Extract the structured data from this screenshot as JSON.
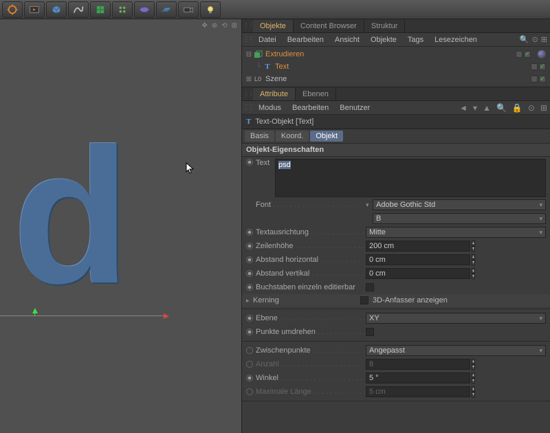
{
  "panel_tabs": {
    "objects": "Objekte",
    "content_browser": "Content Browser",
    "structure": "Struktur"
  },
  "obj_menu": {
    "file": "Datei",
    "edit": "Bearbeiten",
    "view": "Ansicht",
    "objects": "Objekte",
    "tags": "Tags",
    "bookmarks": "Lesezeichen"
  },
  "hierarchy": {
    "extrude": "Extrudieren",
    "text": "Text",
    "scene": "Szene"
  },
  "attr_tabs": {
    "attribute": "Attribute",
    "layers": "Ebenen"
  },
  "attr_menu": {
    "mode": "Modus",
    "edit": "Bearbeiten",
    "user": "Benutzer"
  },
  "attr_title": "Text-Objekt [Text]",
  "subtabs": {
    "basic": "Basis",
    "coord": "Koord.",
    "object": "Objekt"
  },
  "section": "Objekt-Eigenschaften",
  "props": {
    "text_label": "Text",
    "text_value": "psd",
    "font_label": "Font",
    "font_value": "Adobe Gothic Std",
    "font_weight": "B",
    "align_label": "Textausrichtung",
    "align_value": "Mitte",
    "lineheight_label": "Zeilenhöhe",
    "lineheight_value": "200 cm",
    "hspacing_label": "Abstand horizontal",
    "hspacing_value": "0 cm",
    "vspacing_label": "Abstand vertikal",
    "vspacing_value": "0 cm",
    "editable_label": "Buchstaben einzeln editierbar",
    "kerning_label": "Kerning",
    "show3d_label": "3D-Anfasser anzeigen",
    "plane_label": "Ebene",
    "plane_value": "XY",
    "flip_label": "Punkte umdrehen",
    "interp_label": "Zwischenpunkte",
    "interp_value": "Angepasst",
    "count_label": "Anzahl",
    "count_value": "8",
    "angle_label": "Winkel",
    "angle_value": "5 °",
    "maxlen_label": "Maximale Länge",
    "maxlen_value": "5 cm"
  }
}
